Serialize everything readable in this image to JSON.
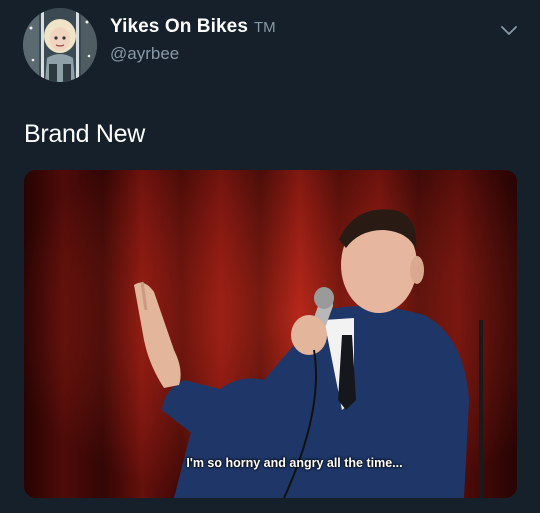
{
  "author": {
    "display_name": "Yikes On Bikes",
    "tm": "TM",
    "handle": "@ayrbee"
  },
  "icons": {
    "avatar": "bitmoji-avatar",
    "menu": "chevron-down-icon"
  },
  "tweet": {
    "text": "Brand New"
  },
  "media": {
    "caption": "I'm so horny and angry all the time..."
  },
  "colors": {
    "background": "#15202b",
    "text": "#ffffff",
    "secondary": "#8899a6",
    "curtain": "#8b1410"
  }
}
